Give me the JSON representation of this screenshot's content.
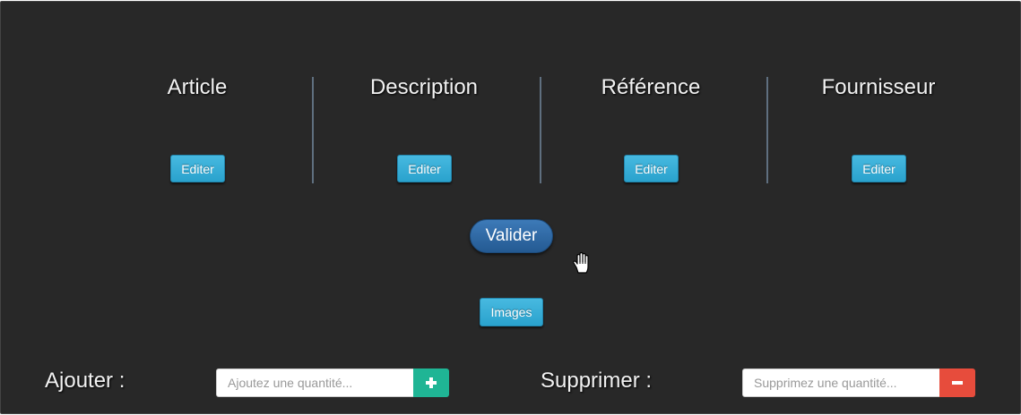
{
  "columns": [
    {
      "title": "Article",
      "button": "Editer"
    },
    {
      "title": "Description",
      "button": "Editer"
    },
    {
      "title": "Référence",
      "button": "Editer"
    },
    {
      "title": "Fournisseur",
      "button": "Editer"
    }
  ],
  "actions": {
    "validate_label": "Valider",
    "images_label": "Images"
  },
  "add": {
    "label": "Ajouter :",
    "placeholder": "Ajoutez une quantité...",
    "button_icon": "plus-icon"
  },
  "remove": {
    "label": "Supprimer :",
    "placeholder": "Supprimez une quantité...",
    "button_icon": "minus-icon"
  },
  "colors": {
    "background": "#282828",
    "edit_button": "#2aa2cd",
    "validate_button": "#245a92",
    "add_button": "#1fb595",
    "remove_button": "#e74c3c"
  }
}
